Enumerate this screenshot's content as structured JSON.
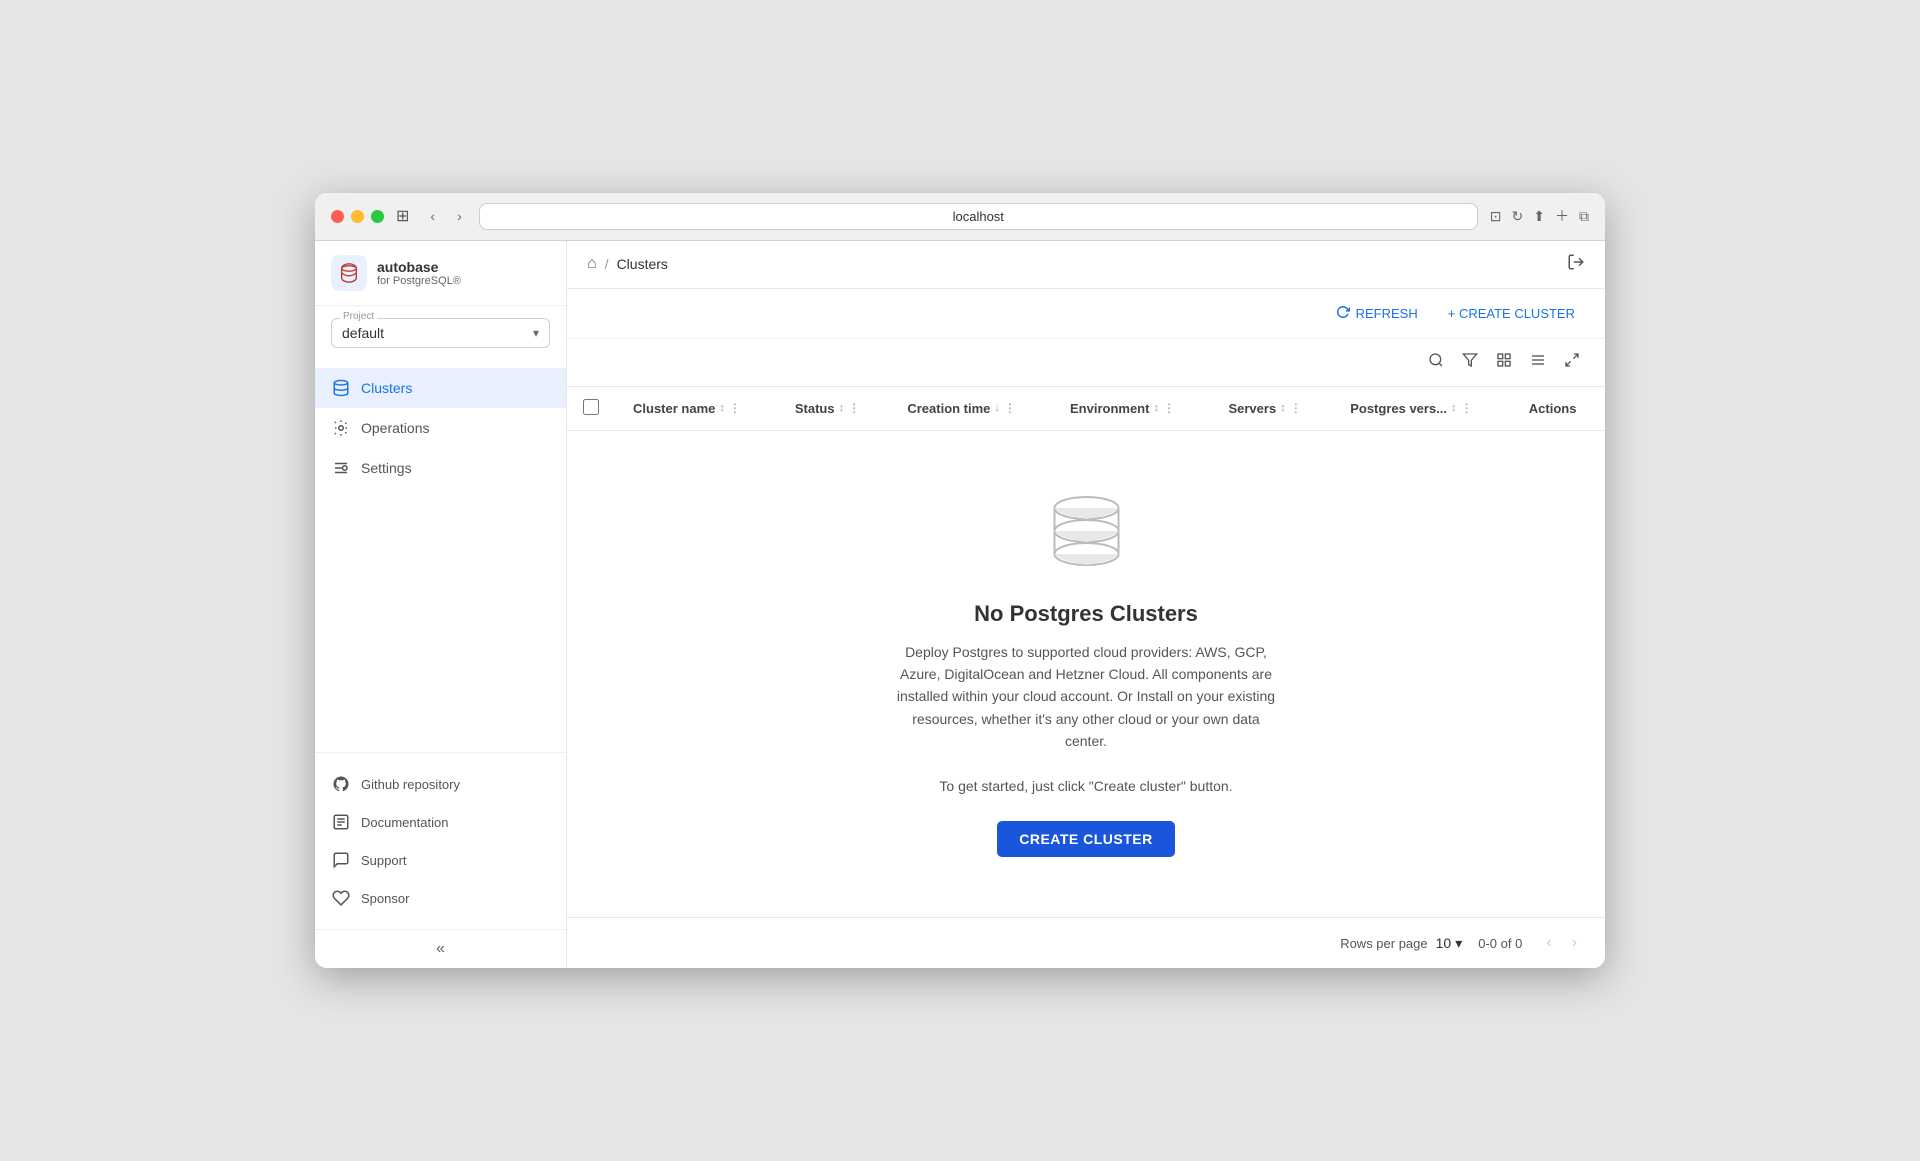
{
  "browser": {
    "address": "localhost"
  },
  "app": {
    "name": "autobase",
    "subtitle": "for PostgreSQL®",
    "logo_char": "🔴"
  },
  "project": {
    "label": "Project",
    "name": "default"
  },
  "nav": {
    "items": [
      {
        "id": "clusters",
        "label": "Clusters",
        "active": true
      },
      {
        "id": "operations",
        "label": "Operations",
        "active": false
      },
      {
        "id": "settings",
        "label": "Settings",
        "active": false
      }
    ]
  },
  "sidebar_footer": {
    "items": [
      {
        "id": "github",
        "label": "Github repository"
      },
      {
        "id": "docs",
        "label": "Documentation"
      },
      {
        "id": "support",
        "label": "Support"
      },
      {
        "id": "sponsor",
        "label": "Sponsor"
      }
    ]
  },
  "breadcrumb": {
    "home_title": "Home",
    "separator": "/",
    "current": "Clusters"
  },
  "toolbar": {
    "refresh_label": "REFRESH",
    "create_label": "+ CREATE CLUSTER"
  },
  "table": {
    "columns": [
      {
        "id": "cluster_name",
        "label": "Cluster name"
      },
      {
        "id": "status",
        "label": "Status"
      },
      {
        "id": "creation_time",
        "label": "Creation time"
      },
      {
        "id": "environment",
        "label": "Environment"
      },
      {
        "id": "servers",
        "label": "Servers"
      },
      {
        "id": "postgres_version",
        "label": "Postgres vers..."
      },
      {
        "id": "actions",
        "label": "Actions"
      }
    ],
    "rows": []
  },
  "empty_state": {
    "title": "No Postgres Clusters",
    "description": "Deploy Postgres to supported cloud providers: AWS, GCP, Azure, DigitalOcean and Hetzner Cloud. All components are installed within your cloud account. Or Install on your existing resources, whether it's any other cloud or your own data center.",
    "hint": "To get started, just click \"Create cluster\" button.",
    "create_btn": "CREATE CLUSTER"
  },
  "pagination": {
    "rows_per_page_label": "Rows per page",
    "rows_per_page_value": "10",
    "info": "0-0 of 0"
  },
  "colors": {
    "accent": "#1a56db",
    "active_nav_bg": "#e8f0fe",
    "active_nav_text": "#1a73e8"
  }
}
